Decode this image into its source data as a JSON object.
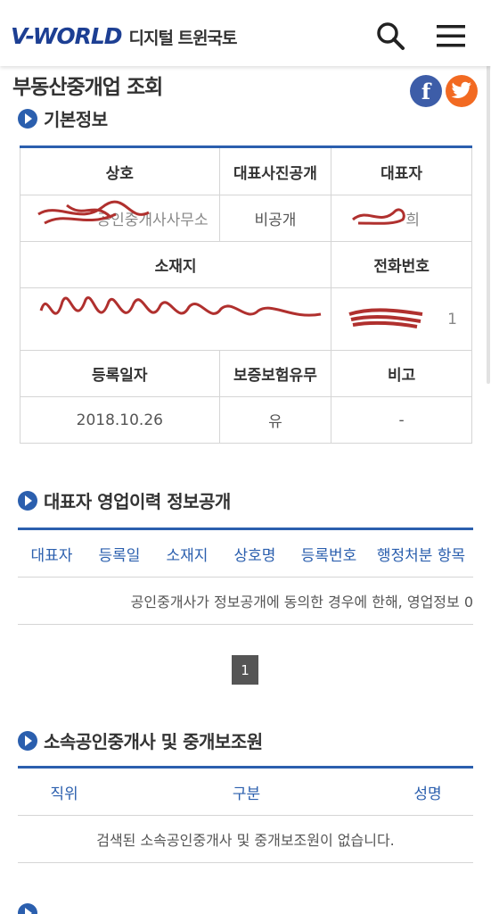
{
  "header": {
    "logo_mark": "V-WORLD",
    "logo_sub": "디지털 트윈국토",
    "search_icon": "search-icon",
    "menu_icon": "hamburger-menu-icon"
  },
  "page_title": "부동산중개업 조회",
  "share": {
    "facebook": "f"
  },
  "basic_info": {
    "title": "기본정보",
    "row1_headers": [
      "상호",
      "대표사진공개",
      "대표자"
    ],
    "row1_values": [
      "공인중개사사무소",
      "비공개",
      "희"
    ],
    "row2_headers": [
      "소재지",
      "전화번호"
    ],
    "row2_values": [
      "",
      "1"
    ],
    "row3_headers": [
      "등록일자",
      "보증보험유무",
      "비고"
    ],
    "row3_values": [
      "2018.10.26",
      "유",
      "-"
    ]
  },
  "history": {
    "title": "대표자 영업이력 정보공개",
    "columns": [
      "대표자",
      "등록일",
      "소재지",
      "상호명",
      "등록번호",
      "행정처분 항목"
    ],
    "message": "공인중개사가 정보공개에 동의한 경우에 한해, 영업정보 0"
  },
  "pagination": {
    "current_page": "1"
  },
  "staff": {
    "title": "소속공인중개사 및 중개보조원",
    "columns": [
      "직위",
      "구분",
      "성명"
    ],
    "message": "검색된 소속공인중개사 및 중개보조원이 없습니다."
  },
  "colors": {
    "brand": "#1d3f93",
    "accent": "#2b5fae",
    "redaction": "#b0302e"
  }
}
